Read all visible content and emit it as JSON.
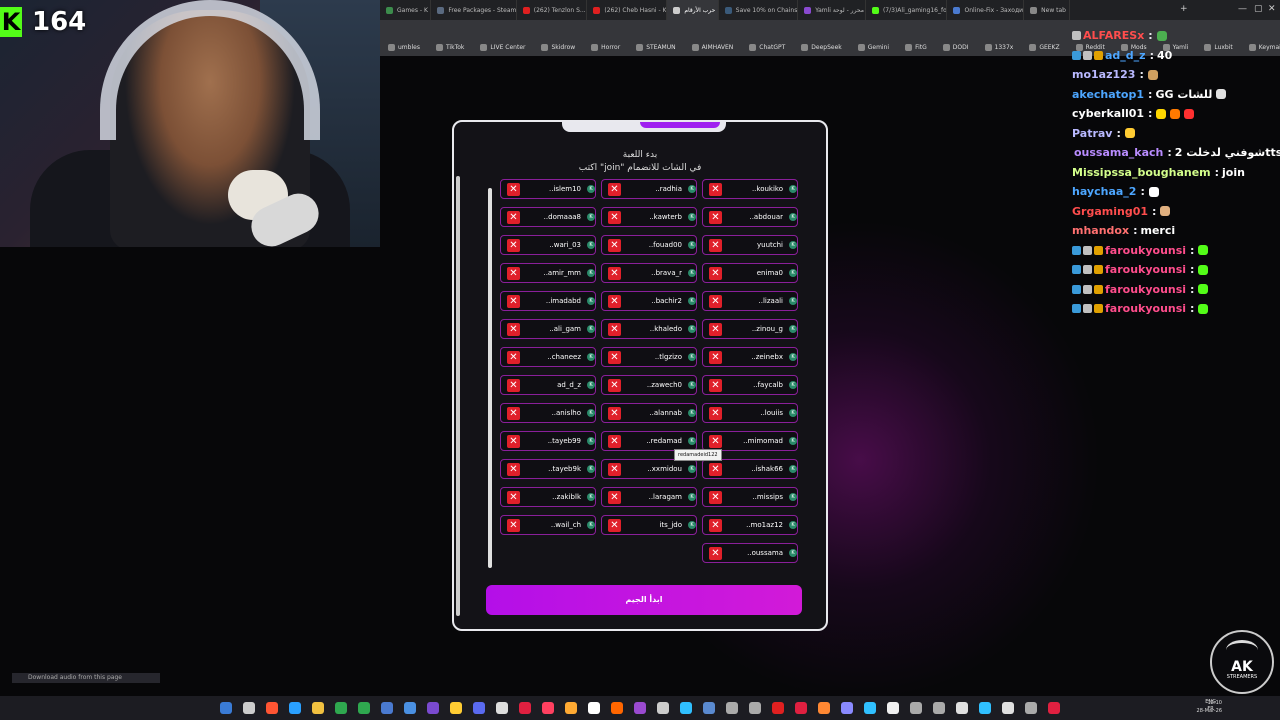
{
  "stream": {
    "viewer_count": "164",
    "kick_letter": "K"
  },
  "browser": {
    "tabs": [
      {
        "title": "Games - K",
        "color": "#3c8c4c"
      },
      {
        "title": "Free Packages - Steam",
        "color": "#5a6a80"
      },
      {
        "title": "(262) Tenzlon S...",
        "color": "#e02020"
      },
      {
        "title": "(262) Cheb Hasni - K",
        "color": "#e02020"
      },
      {
        "title": "حرب الأرقام",
        "color": "#cccccc"
      },
      {
        "title": "Save 10% on Chains",
        "color": "#3a5a7a"
      },
      {
        "title": "Yamli محرر - لوحة",
        "color": "#8a4ad0"
      },
      {
        "title": "(7/3)Ali_gaming16_fo",
        "color": "#53fc18"
      },
      {
        "title": "Online-Fix - Заходи",
        "color": "#4a7ad0"
      },
      {
        "title": "New tab",
        "color": "#888888"
      }
    ],
    "bookmarks": [
      "umbles",
      "TikTok",
      "LIVE Center",
      "Skidrow",
      "Horror",
      "STEAMUN",
      "AIMHAVEN",
      "ChatGPT",
      "DeepSeek",
      "Gemini",
      "FitG",
      "DODI",
      "1337x",
      "GEEKZ",
      "Reddit",
      "Mods",
      "Yamli",
      "Luxbit",
      "Keymailer",
      "Other favorites"
    ],
    "window_controls": [
      "—",
      "▢",
      "✕"
    ],
    "new_tab": "+"
  },
  "chat": {
    "messages": [
      {
        "user": "ALFARESx",
        "text": "",
        "color": "#ff4d4d",
        "badges": [
          "#c0c0c0"
        ],
        "emotes": [
          "#4caf50"
        ]
      },
      {
        "user": "ad_d_z",
        "text": "40",
        "color": "#4da6ff",
        "badges": [
          "#3a9ad9",
          "#c0c0c0",
          "#e0a000"
        ],
        "emotes": []
      },
      {
        "user": "mo1az123",
        "text": "",
        "color": "#b9b9ff",
        "badges": [],
        "emotes": [
          "#d0a060"
        ]
      },
      {
        "user": "akechatop1",
        "text": "GG للشات",
        "color": "#4da6ff",
        "badges": [],
        "emotes": [
          "#e0e0e0"
        ]
      },
      {
        "user": "cyberkall01",
        "text": "",
        "color": "#ffffff",
        "badges": [],
        "emotes": [
          "#ffd700",
          "#ff7a00",
          "#ff3030"
        ]
      },
      {
        "user": "Patrav",
        "text": "",
        "color": "#b9b9ff",
        "badges": [],
        "emotes": [
          "#ffcc33"
        ]
      },
      {
        "user": "oussama_kach",
        "text": "شوفني لدخلت 2tts!!",
        "color": "#b98cff",
        "badges": [
          "#3ad98a"
        ],
        "emotes": []
      },
      {
        "user": "Missipssa_boughanem",
        "text": "join",
        "color": "#d4ff8c",
        "badges": [],
        "emotes": []
      },
      {
        "user": "haychaa_2",
        "text": "",
        "color": "#4da6ff",
        "badges": [],
        "emotes": [
          "#ffffff"
        ]
      },
      {
        "user": "Grgaming01",
        "text": "",
        "color": "#ff4d4d",
        "badges": [],
        "emotes": [
          "#e0b080"
        ]
      },
      {
        "user": "mhandox",
        "text": "merci",
        "color": "#ff7070",
        "badges": [],
        "emotes": []
      },
      {
        "user": "faroukyounsi",
        "text": "",
        "color": "#ff4d8c",
        "badges": [
          "#3a9ad9",
          "#c0c0c0",
          "#e0a000"
        ],
        "emotes": [
          "#53fc18"
        ]
      },
      {
        "user": "faroukyounsi",
        "text": "",
        "color": "#ff4d8c",
        "badges": [
          "#3a9ad9",
          "#c0c0c0",
          "#e0a000"
        ],
        "emotes": [
          "#53fc18"
        ]
      },
      {
        "user": "faroukyounsi",
        "text": "",
        "color": "#ff4d8c",
        "badges": [
          "#3a9ad9",
          "#c0c0c0",
          "#e0a000"
        ],
        "emotes": [
          "#53fc18"
        ]
      },
      {
        "user": "faroukyounsi",
        "text": "",
        "color": "#ff4d8c",
        "badges": [
          "#3a9ad9",
          "#c0c0c0",
          "#e0a000"
        ],
        "emotes": [
          "#53fc18"
        ]
      }
    ]
  },
  "modal": {
    "title": "بدء اللعبة",
    "subtitle": "اكتب \"join\" في الشات للانضمام",
    "remove_icon": "✕",
    "platform_icon": "K",
    "players": [
      "..islem10",
      "..radhia",
      "..koukiko",
      "..domaaa8",
      "..kawterb",
      "..abdouar",
      "..wari_03",
      "..fouad00",
      "yuutchi",
      "..amir_mm",
      "..brava_r",
      "enima0",
      "..imadabd",
      "..bachir2",
      "..lizaali",
      "..ali_gam",
      "..khaledo",
      "..zinou_g",
      "..chaneez",
      "..tlgzizo",
      "..zeinebx",
      "ad_d_z",
      "..zawech0",
      "..faycalb",
      "..anislho",
      "..alannab",
      "..louiis",
      "..tayeb99",
      "..redamad",
      "..mimomad",
      "..tayeb9k",
      "..xxmidou",
      "..ishak66",
      "..zakiblk",
      "..laragam",
      "..missips",
      "..wail_ch",
      "its_jdo",
      "..mo1az12",
      "",
      "",
      "..oussama"
    ],
    "tooltip": "redamadeid122",
    "start_button": "ابدأ الجيم"
  },
  "taskbar": {
    "icon_colors": [
      "#3a7bd5",
      "#cccccc",
      "#ff5533",
      "#2aa0ff",
      "#f0c040",
      "#2fa84f",
      "#2fa84f",
      "#4a7ad0",
      "#4a90e2",
      "#7a4ad0",
      "#ffcc33",
      "#5a6af0",
      "#dddddd",
      "#e02040",
      "#ff4060",
      "#ffaa33",
      "#ffffff",
      "#ff6600",
      "#9a4ad0",
      "#cccccc",
      "#30c0ff",
      "#5a8ad0",
      "#aaaaaa",
      "#aaaaaa",
      "#e02020",
      "#e02040",
      "#ff8833",
      "#8a8aff",
      "#30c0ff",
      "#f0f0f0",
      "#aaaaaa",
      "#aaaaaa",
      "#e0e0e0",
      "#30c0ff",
      "#e0e0e0",
      "#aaaaaa",
      "#e02040"
    ],
    "lang": "ENG",
    "region": "FR",
    "time": "12:10",
    "date": "28-Mar-26"
  },
  "download_bar": "Download audio from this page",
  "logo": {
    "name": "AK",
    "caption": "STREAMERS"
  }
}
